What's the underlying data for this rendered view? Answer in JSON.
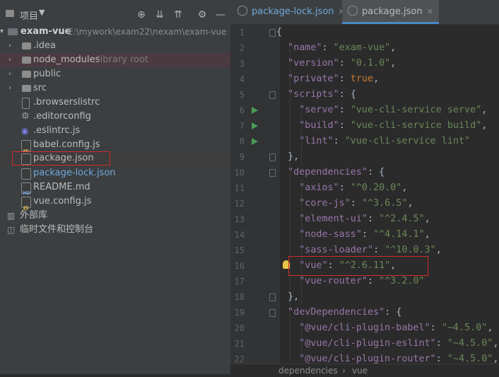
{
  "project_panel": {
    "title": "项目",
    "dropdown_icon": "triangle-down",
    "tools": [
      "locate-icon",
      "expand-all-icon",
      "collapse-all-icon",
      "settings-icon",
      "hide-icon"
    ],
    "root": {
      "name": "exam-vue",
      "path": "E:\\mywork\\exam22\\nexam\\exam-vue"
    },
    "items": [
      {
        "label": ".idea",
        "kind": "folder"
      },
      {
        "label": "node_modules",
        "kind": "folder",
        "note": "library root"
      },
      {
        "label": "public",
        "kind": "folder"
      },
      {
        "label": "src",
        "kind": "folder"
      },
      {
        "label": ".browserslistrc",
        "kind": "file"
      },
      {
        "label": ".editorconfig",
        "kind": "file"
      },
      {
        "label": ".eslintrc.js",
        "kind": "file"
      },
      {
        "label": "babel.config.js",
        "kind": "file"
      },
      {
        "label": "package.json",
        "kind": "file"
      },
      {
        "label": "package-lock.json",
        "kind": "file"
      },
      {
        "label": "README.md",
        "kind": "file"
      },
      {
        "label": "vue.config.js",
        "kind": "file"
      }
    ],
    "external_libs": "外部库",
    "scratches": "临时文件和控制台"
  },
  "editor": {
    "tabs": [
      {
        "label": "package-lock.json",
        "active": false
      },
      {
        "label": "package.json",
        "active": true
      }
    ],
    "line_numbers": [
      "1",
      "2",
      "3",
      "4",
      "5",
      "6",
      "7",
      "8",
      "9",
      "10",
      "11",
      "12",
      "13",
      "14",
      "15",
      "16",
      "17",
      "18",
      "19",
      "20",
      "21",
      "22"
    ],
    "lines": [
      {
        "indent": "",
        "key": "",
        "sep": "",
        "val": "",
        "tail": "{"
      },
      {
        "indent": "  ",
        "key": "\"name\"",
        "sep": ": ",
        "val": "\"exam-vue\"",
        "tail": ","
      },
      {
        "indent": "  ",
        "key": "\"version\"",
        "sep": ": ",
        "val": "\"0.1.0\"",
        "tail": ","
      },
      {
        "indent": "  ",
        "key": "\"private\"",
        "sep": ": ",
        "val": "",
        "kw": "true",
        "tail": ","
      },
      {
        "indent": "  ",
        "key": "\"scripts\"",
        "sep": ": ",
        "val": "",
        "tail": "{"
      },
      {
        "indent": "    ",
        "key": "\"serve\"",
        "sep": ": ",
        "val": "\"vue-cli-service serve\"",
        "tail": ","
      },
      {
        "indent": "    ",
        "key": "\"build\"",
        "sep": ": ",
        "val": "\"vue-cli-service build\"",
        "tail": ","
      },
      {
        "indent": "    ",
        "key": "\"lint\"",
        "sep": ": ",
        "val": "\"vue-cli-service lint\"",
        "tail": ""
      },
      {
        "indent": "  ",
        "key": "",
        "sep": "",
        "val": "",
        "tail": "},"
      },
      {
        "indent": "  ",
        "key": "\"dependencies\"",
        "sep": ": ",
        "val": "",
        "tail": "{"
      },
      {
        "indent": "    ",
        "key": "\"axios\"",
        "sep": ": ",
        "val": "\"^0.20.0\"",
        "tail": ","
      },
      {
        "indent": "    ",
        "key": "\"core-js\"",
        "sep": ": ",
        "val": "\"^3.6.5\"",
        "tail": ","
      },
      {
        "indent": "    ",
        "key": "\"element-ui\"",
        "sep": ": ",
        "val": "\"^2.4.5\"",
        "tail": ","
      },
      {
        "indent": "    ",
        "key": "\"node-sass\"",
        "sep": ": ",
        "val": "\"^4.14.1\"",
        "tail": ","
      },
      {
        "indent": "    ",
        "key": "\"sass-loader\"",
        "sep": ": ",
        "val": "\"^10.0.3\"",
        "tail": ","
      },
      {
        "indent": "    ",
        "key": "\"vue\"",
        "sep": ": ",
        "val": "\"^2.6.11\"",
        "tail": ","
      },
      {
        "indent": "    ",
        "key": "\"vue-router\"",
        "sep": ": ",
        "val": "\"^3.2.0\"",
        "tail": ""
      },
      {
        "indent": "  ",
        "key": "",
        "sep": "",
        "val": "",
        "tail": "},"
      },
      {
        "indent": "  ",
        "key": "\"devDependencies\"",
        "sep": ": ",
        "val": "",
        "tail": "{"
      },
      {
        "indent": "    ",
        "key": "\"@vue/cli-plugin-babel\"",
        "sep": ": ",
        "val": "\"~4.5.0\"",
        "tail": ","
      },
      {
        "indent": "    ",
        "key": "\"@vue/cli-plugin-eslint\"",
        "sep": ": ",
        "val": "\"~4.5.0\"",
        "tail": ","
      },
      {
        "indent": "    ",
        "key": "\"@vue/cli-plugin-router\"",
        "sep": ": ",
        "val": "\"~4.5.0\"",
        "tail": ","
      }
    ],
    "run_lines": [
      6,
      7,
      8
    ],
    "breadcrumb": [
      "dependencies",
      "vue"
    ],
    "breadcrumb_sep": "›"
  },
  "colors": {
    "panel_bg": "#3c3f41",
    "editor_bg": "#2b2b2b",
    "json_key": "#9876aa",
    "json_string": "#6a8759",
    "keyword": "#cc7832",
    "highlight_box": "#d12b2b",
    "link_file": "#6fa8dc"
  }
}
